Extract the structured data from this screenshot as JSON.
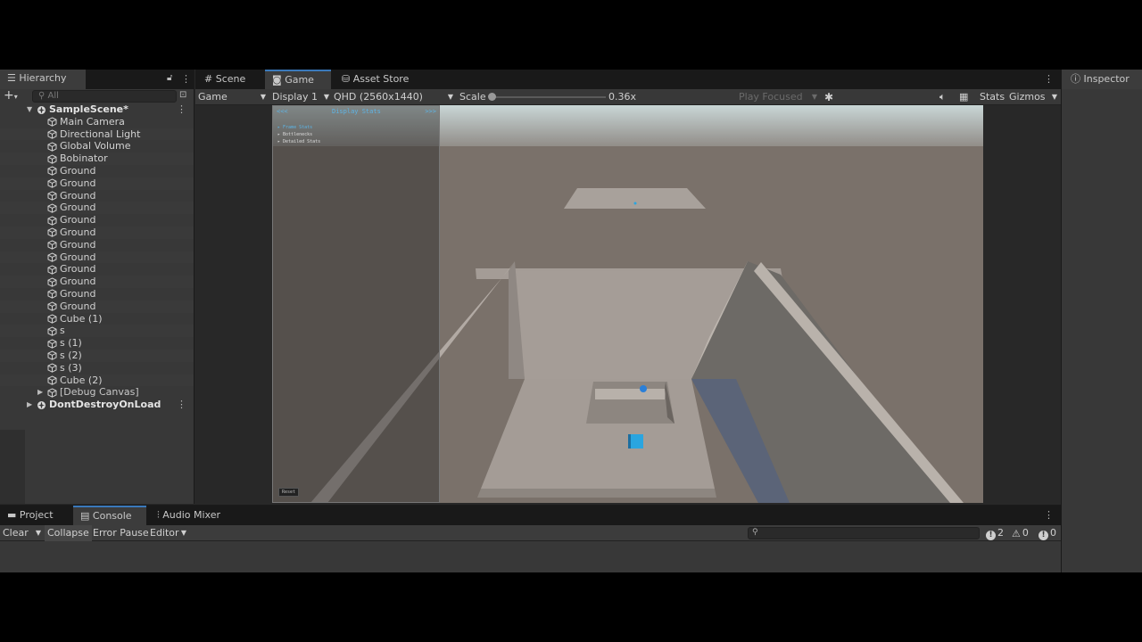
{
  "hierarchy": {
    "tab_label": "Hierarchy",
    "search_placeholder": "All",
    "scene": "SampleScene*",
    "items": [
      "Main Camera",
      "Directional Light",
      "Global Volume",
      "Bobinator",
      "Ground",
      "Ground",
      "Ground",
      "Ground",
      "Ground",
      "Ground",
      "Ground",
      "Ground",
      "Ground",
      "Ground",
      "Ground",
      "Ground",
      "Cube (1)",
      "s",
      "s (1)",
      "s (2)",
      "s (3)",
      "Cube (2)"
    ],
    "debug_canvas": "[Debug Canvas]",
    "dont_destroy": "DontDestroyOnLoad"
  },
  "game_tabs": {
    "scene": "Scene",
    "game": "Game",
    "asset_store": "Asset Store"
  },
  "game_toolbar": {
    "mode": "Game",
    "display": "Display 1",
    "resolution": "QHD (2560x1440)",
    "scale_label": "Scale",
    "scale_value": "0.36x",
    "scale_fraction": 0.0,
    "play_focused": "Play Focused",
    "stats": "Stats",
    "gizmos": "Gizmos"
  },
  "debug_overlay": {
    "left_nav": "<<<",
    "title": "Display Stats",
    "right_nav": ">>>",
    "items": [
      "Frame Stats",
      "Bottlenecks",
      "Detailed Stats"
    ],
    "reset": "Reset"
  },
  "inspector": {
    "tab_label": "Inspector"
  },
  "bottom_tabs": {
    "project": "Project",
    "console": "Console",
    "audio_mixer": "Audio Mixer"
  },
  "console_toolbar": {
    "clear": "Clear",
    "collapse": "Collapse",
    "error_pause": "Error Pause",
    "editor": "Editor",
    "info_count": "2",
    "warning_count": "0",
    "error_count": "0"
  },
  "colors": {
    "accent": "#3a79bb",
    "panel": "#383838",
    "tab_bar": "#191919",
    "sky": "#c9d6d6",
    "ground": "#7a716a",
    "walls": "#a49c96",
    "blue_object": "#2aa5e0"
  }
}
